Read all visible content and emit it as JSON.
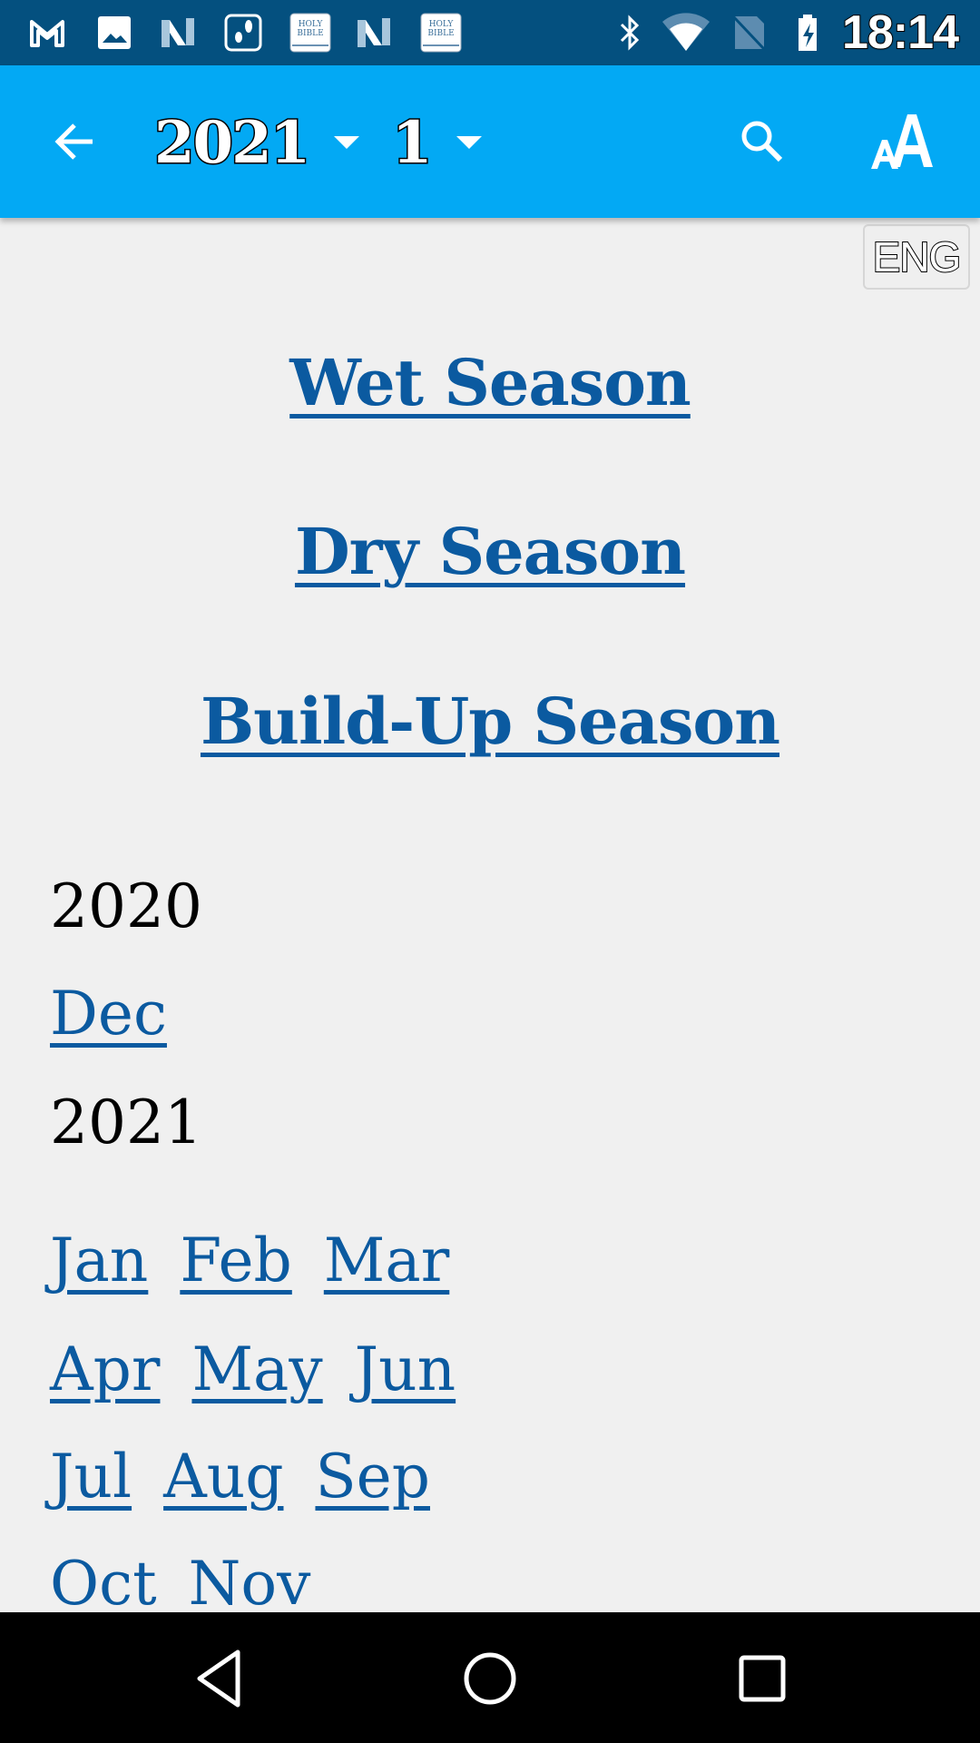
{
  "status_bar": {
    "time": "18:14",
    "notification_icons": [
      "gmail-icon",
      "gallery-icon",
      "n-app-icon",
      "footsteps-icon",
      "holy-bible-icon",
      "n-app-icon",
      "holy-bible-icon"
    ],
    "bible_icon_text": [
      "HOLY",
      "BIBLE"
    ],
    "system_icons": [
      "bluetooth-icon",
      "wifi-icon",
      "no-sim-icon",
      "battery-charging-icon"
    ]
  },
  "app_bar": {
    "year_value": "2021",
    "month_value": "1",
    "font_size_label": "AA"
  },
  "language_button": "ENG",
  "seasons": [
    "Wet Season",
    "Dry Season",
    "Build-Up Season"
  ],
  "archive": {
    "year_2020": "2020",
    "months_2020": [
      "Dec"
    ],
    "year_2021": "2021",
    "months_2021_rows": [
      [
        "Jan",
        "Feb",
        "Mar"
      ],
      [
        "Apr",
        "May",
        "Jun"
      ],
      [
        "Jul",
        "Aug",
        "Sep"
      ],
      [
        "Oct",
        "Nov"
      ]
    ]
  },
  "colors": {
    "status_bar": "#04507f",
    "app_bar": "#03a9f4",
    "link": "#0b5aa0",
    "background": "#f0f0f0"
  }
}
